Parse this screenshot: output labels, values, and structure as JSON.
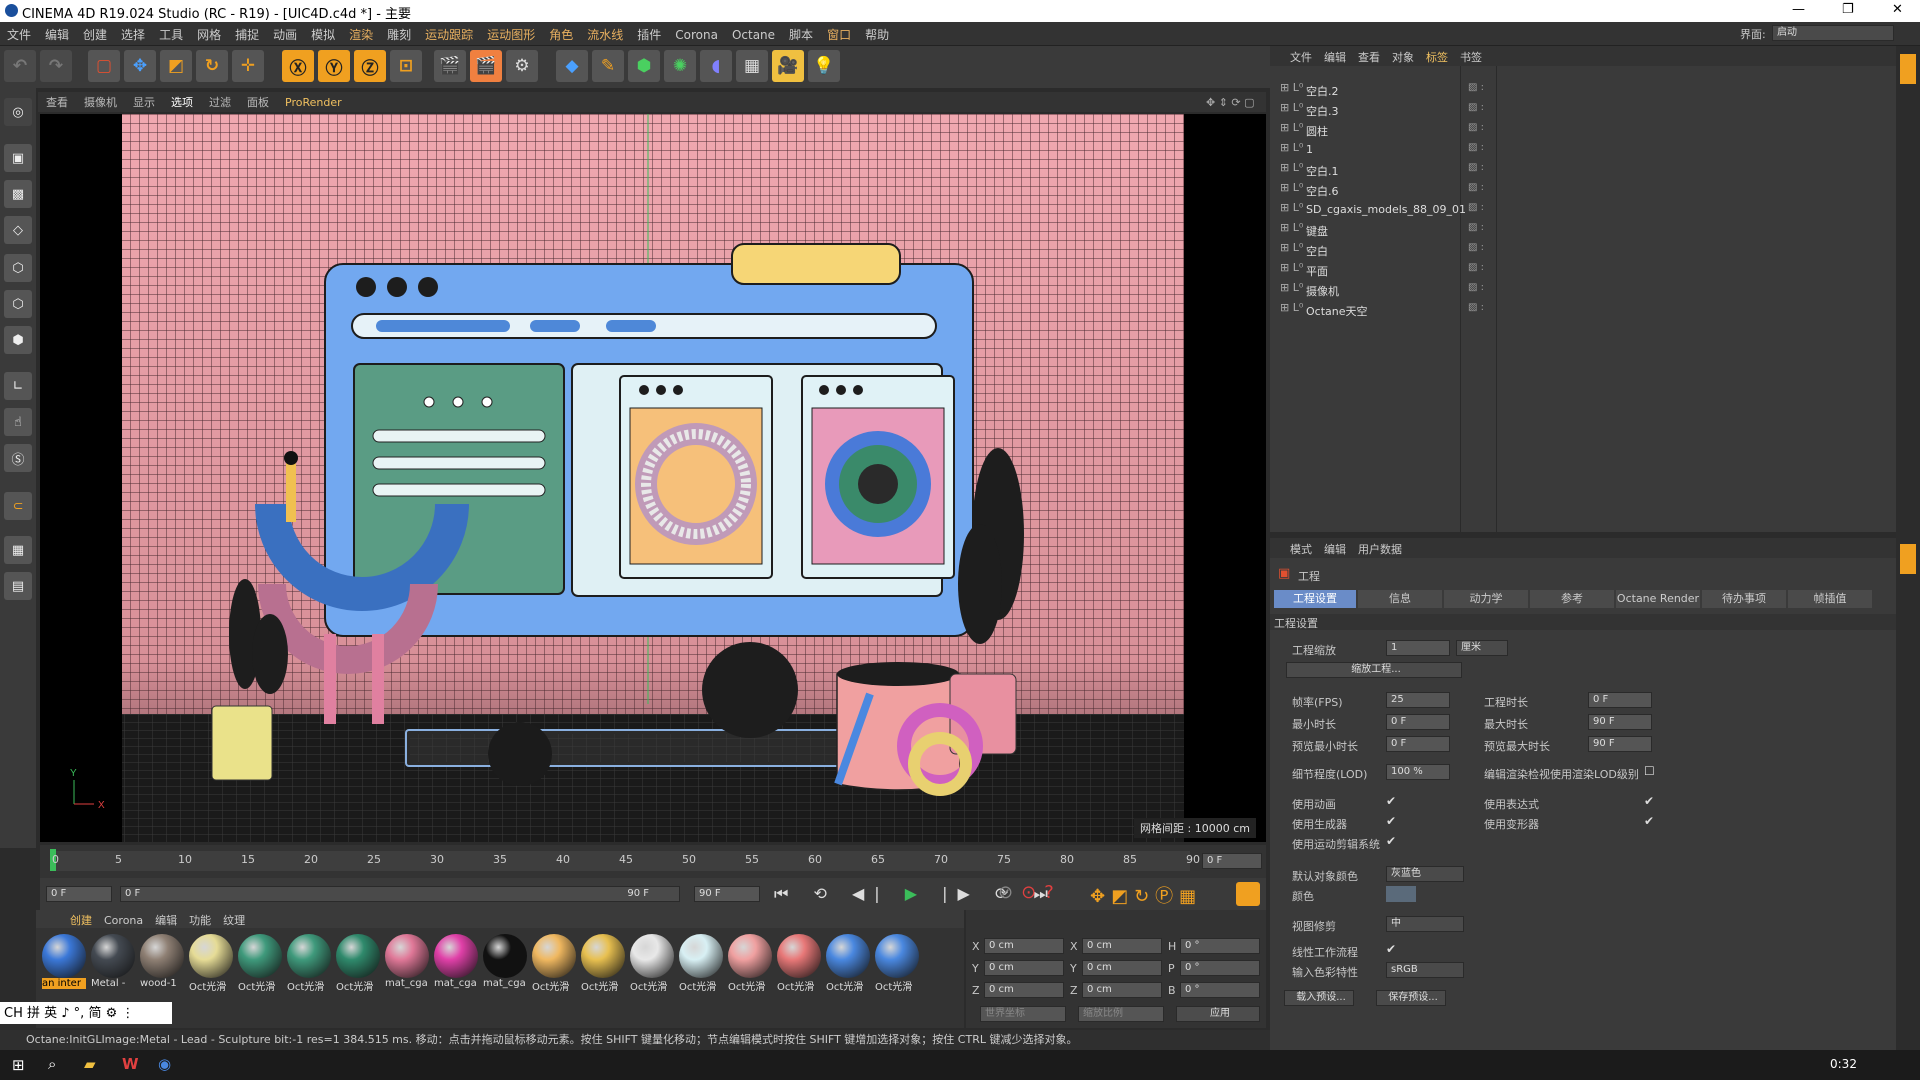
{
  "title": "CINEMA 4D R19.024 Studio (RC - R19) - [UIC4D.c4d *] - 主要",
  "menu": [
    "文件",
    "编辑",
    "创建",
    "选择",
    "工具",
    "网格",
    "捕捉",
    "动画",
    "模拟",
    "渲染",
    "雕刻",
    "运动跟踪",
    "运动图形",
    "角色",
    "流水线",
    "插件",
    "Corona",
    "Octane",
    "脚本",
    "窗口",
    "帮助"
  ],
  "layout_label": "界面:",
  "layout_value": "启动",
  "viewport_menu": [
    "查看",
    "摄像机",
    "显示",
    "选项",
    "过滤",
    "面板",
    "ProRender"
  ],
  "grid_info": "网格间距 : 10000 cm",
  "timeline": {
    "ticks": [
      "0",
      "5",
      "10",
      "15",
      "20",
      "25",
      "30",
      "35",
      "40",
      "45",
      "50",
      "55",
      "60",
      "65",
      "70",
      "75",
      "80",
      "85",
      "90"
    ],
    "end": "0 F"
  },
  "playbar": {
    "start": "0 F",
    "range_start": "0 F",
    "range_end": "90 F",
    "end": "90 F"
  },
  "mat_menu": [
    "创建",
    "Corona",
    "编辑",
    "功能",
    "纹理"
  ],
  "materials": [
    {
      "label": "an inter",
      "color": "#3b78d8"
    },
    {
      "label": "Metal -",
      "color": "#444a52"
    },
    {
      "label": "wood-1",
      "color": "#8f8074"
    },
    {
      "label": "Oct光滑",
      "color": "#e6dc96"
    },
    {
      "label": "Oct光滑",
      "color": "#3f9a7c"
    },
    {
      "label": "Oct光滑",
      "color": "#3f9a7c"
    },
    {
      "label": "Oct光滑",
      "color": "#2f8a6c"
    },
    {
      "label": "mat_cga",
      "color": "#e07898"
    },
    {
      "label": "mat_cga",
      "color": "#e040a8"
    },
    {
      "label": "mat_cga",
      "color": "#111111"
    },
    {
      "label": "Oct光滑",
      "color": "#f0b860"
    },
    {
      "label": "Oct光滑",
      "color": "#e8c050"
    },
    {
      "label": "Oct光滑",
      "color": "#e8e8e8"
    },
    {
      "label": "Oct光滑",
      "color": "#d8f0f4"
    },
    {
      "label": "Oct光滑",
      "color": "#f0a0a0"
    },
    {
      "label": "Oct光滑",
      "color": "#e87878"
    },
    {
      "label": "Oct光滑",
      "color": "#4a88e0"
    },
    {
      "label": "Oct光滑",
      "color": "#4a88e0"
    }
  ],
  "coords": {
    "x": "0 cm",
    "y": "0 cm",
    "z": "0 cm",
    "x2": "0 cm",
    "y2": "0 cm",
    "z2": "0 cm",
    "h": "0 °",
    "p": "0 °",
    "b": "0 °",
    "mode1": "世界坐标",
    "mode2": "缩放比例",
    "apply": "应用"
  },
  "ime": "CH 拼 英 ♪ °, 简 ⚙ ⋮",
  "status": "Octane:InitGLImage:Metal - Lead - Sculpture  bit:-1 res=1  384.515 ms.     移动：点击并拖动鼠标移动元素。按住 SHIFT 键量化移动；节点编辑模式时按住 SHIFT 键增加选择对象；按住 CTRL 键减少选择对象。",
  "objmgr_menu": [
    "文件",
    "编辑",
    "查看",
    "对象",
    "标签",
    "书签"
  ],
  "objects": [
    "空白.2",
    "空白.3",
    "圆柱",
    "1",
    "空白.1",
    "空白.6",
    "SD_cgaxis_models_88_09_01",
    "键盘",
    "空白",
    "平面",
    "摄像机",
    "Octane天空"
  ],
  "attr_menu": [
    "模式",
    "编辑",
    "用户数据"
  ],
  "attr_title": "工程",
  "attr_tabs": [
    "工程设置",
    "信息",
    "动力学",
    "参考",
    "Octane Render",
    "待办事项",
    "帧插值"
  ],
  "section": "工程设置",
  "fields": {
    "scale_label": "工程缩放",
    "scale_val": "1",
    "scale_unit": "厘米",
    "scale_btn": "缩放工程...",
    "fps_label": "帧率(FPS)",
    "fps": "25",
    "dur_label": "工程时长",
    "dur": "0 F",
    "min_label": "最小时长",
    "min": "0 F",
    "max_label": "最大时长",
    "max": "90 F",
    "pmin_label": "预览最小时长",
    "pmin": "0 F",
    "pmax_label": "预览最大时长",
    "pmax": "90 F",
    "lod_label": "细节程度(LOD)",
    "lod": "100 %",
    "lod_chk_label": "编辑渲染检视使用渲染LOD级别",
    "anim_label": "使用动画",
    "expr_label": "使用表达式",
    "gen_label": "使用生成器",
    "deform_label": "使用变形器",
    "motion_label": "使用运动剪辑系统",
    "color_label": "默认对象颜色",
    "color_val": "灰蓝色",
    "color2_label": "颜色",
    "clip_label": "视图修剪",
    "clip_val": "中",
    "linear_label": "线性工作流程",
    "input_label": "输入色彩特性",
    "input_val": "sRGB",
    "load": "载入预设...",
    "save": "保存预设..."
  },
  "clock": "0:32"
}
